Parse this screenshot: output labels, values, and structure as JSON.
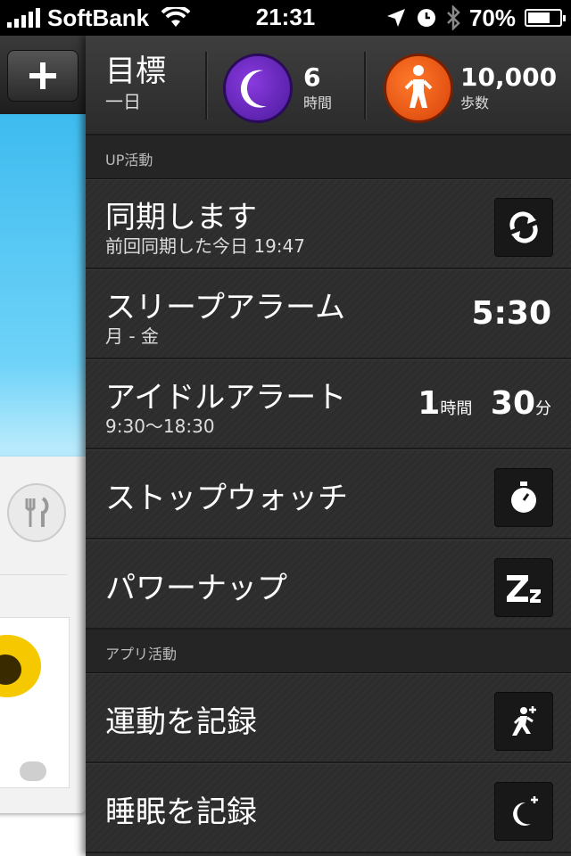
{
  "status": {
    "carrier": "SoftBank",
    "time": "21:31",
    "battery": "70%",
    "battery_level": 0.7
  },
  "goal": {
    "title": "目標",
    "subtitle": "一日",
    "sleep_value": "6",
    "sleep_unit": "時間",
    "steps_value": "10,000",
    "steps_unit": "歩数"
  },
  "sections": {
    "up": "UP活動",
    "app": "アプリ活動"
  },
  "rows": {
    "sync": {
      "title": "同期します",
      "subtitle": "前回同期した今日 19:47"
    },
    "alarm": {
      "title": "スリープアラーム",
      "subtitle": "月 - 金",
      "value": "5:30"
    },
    "idle": {
      "title": "アイドルアラート",
      "subtitle": "9:30〜18:30",
      "hours": "1",
      "hours_unit": "時間",
      "minutes": "30",
      "minutes_unit": "分"
    },
    "stopwatch": {
      "title": "ストップウォッチ"
    },
    "powernap": {
      "title": "パワーナップ"
    },
    "workout": {
      "title": "運動を記録"
    },
    "sleep": {
      "title": "睡眠を記録"
    }
  },
  "icons": {
    "add": "plus-icon",
    "sync": "sync-icon",
    "stopwatch": "stopwatch-icon",
    "nap": "zz-icon",
    "workout": "runner-plus-icon",
    "sleep": "moon-plus-icon"
  },
  "colors": {
    "sleep_accent": "#6a28c8",
    "steps_accent": "#f05a14",
    "panel_bg": "#2e2e2e",
    "left_bg": "#2fb4ec"
  }
}
